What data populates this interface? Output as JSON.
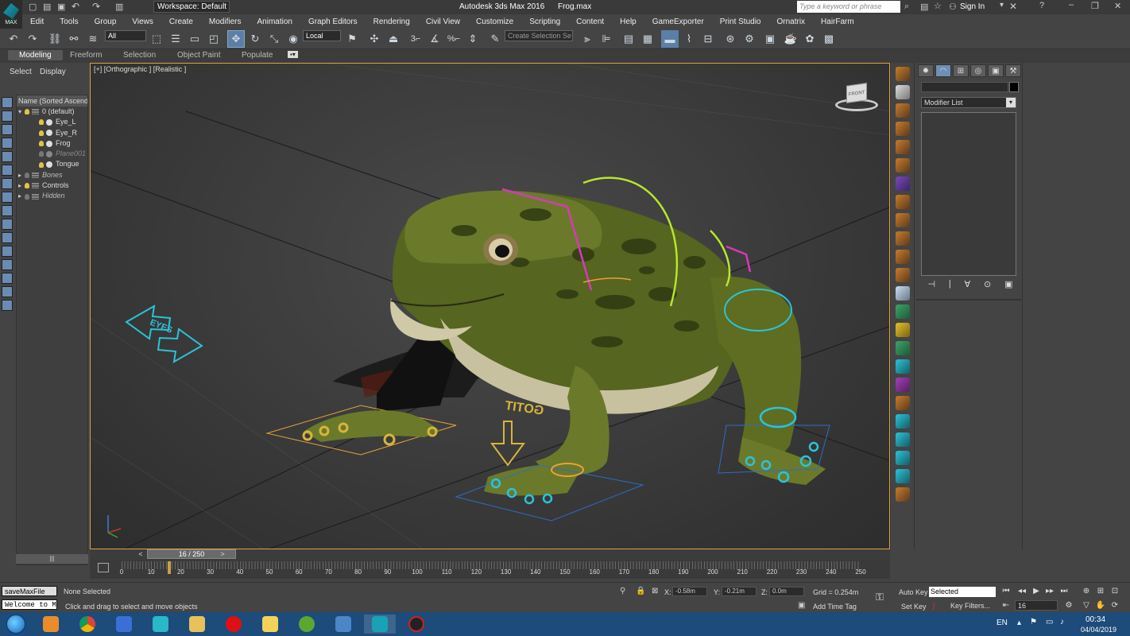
{
  "title": {
    "workspace": "Workspace: Default",
    "app": "Autodesk 3ds Max 2016",
    "file": "Frog.max",
    "search_placeholder": "Type a keyword or phrase",
    "sign_in": "Sign In",
    "logo_text": "MAX"
  },
  "menu": [
    "Edit",
    "Tools",
    "Group",
    "Views",
    "Create",
    "Modifiers",
    "Animation",
    "Graph Editors",
    "Rendering",
    "Civil View",
    "Customize",
    "Scripting",
    "Content",
    "Help",
    "GameExporter",
    "Print Studio",
    "Ornatrix",
    "HairFarm"
  ],
  "toolbar": {
    "selection_filter": "All",
    "ref_coord": "Local",
    "selection_set_placeholder": "Create Selection Se",
    "snap_3": "3",
    "percent": "%"
  },
  "ribbon": {
    "tabs": [
      "Modeling",
      "Freeform",
      "Selection",
      "Object Paint",
      "Populate"
    ]
  },
  "explorer": {
    "tabs": [
      "Select",
      "Display"
    ],
    "header": "Name (Sorted Ascending",
    "rows": [
      {
        "label": "0 (default)"
      },
      {
        "label": "Eye_L"
      },
      {
        "label": "Eye_R"
      },
      {
        "label": "Frog"
      },
      {
        "label": "Plane001"
      },
      {
        "label": "Tongue"
      },
      {
        "label": "Bones"
      },
      {
        "label": "Controls"
      },
      {
        "label": "Hidden"
      }
    ],
    "scroll": "|||"
  },
  "viewport": {
    "label": "[+] [Orthographic ] [Realistic ]",
    "cube_label": "FRONT",
    "ctrl_eyes": "EYES",
    "ctrl_gotit": "GOTIT"
  },
  "command_panel": {
    "tabs": [
      "✹",
      "◠",
      "⊞",
      "◎",
      "▣",
      "⚒"
    ],
    "modifier_list": "Modifier List",
    "stack_tools": [
      "⊣",
      "|",
      "∀",
      "⊙",
      "▣"
    ]
  },
  "timeline": {
    "slider_label": "16 / 250",
    "current_frame": 16,
    "start": 0,
    "end": 250,
    "tick_labels": [
      "0",
      "10",
      "20",
      "30",
      "40",
      "50",
      "60",
      "70",
      "80",
      "90",
      "100",
      "110",
      "120",
      "130",
      "140",
      "150",
      "160",
      "170",
      "180",
      "190",
      "200",
      "210",
      "220",
      "230",
      "240",
      "250"
    ]
  },
  "status": {
    "script_label": "saveMaxFile",
    "listener_text": "Welcome to M",
    "selection": "None Selected",
    "prompt": "Click and drag to select and move objects",
    "x_label": "X:",
    "x_value": "-0.58m",
    "y_label": "Y:",
    "y_value": "-0.21m",
    "z_label": "Z:",
    "z_value": "0.0m",
    "grid": "Grid = 0.254m",
    "add_time_tag": "Add Time Tag",
    "auto_key": "Auto Key",
    "set_key": "Set Key",
    "selected_dd": "Selected",
    "key_filters": "Key Filters...",
    "frame": "16"
  },
  "taskbar": {
    "lang": "EN",
    "time": "00:34",
    "date": "04/04/2019"
  },
  "colors": {
    "viewport_border": "#e0a040",
    "frog_green": "#6b7a2a",
    "ctrl_cyan": "#2cc3d9",
    "ctrl_orange": "#e8a23a",
    "ctrl_magenta": "#d63ab8",
    "ctrl_lime": "#b7e630"
  }
}
